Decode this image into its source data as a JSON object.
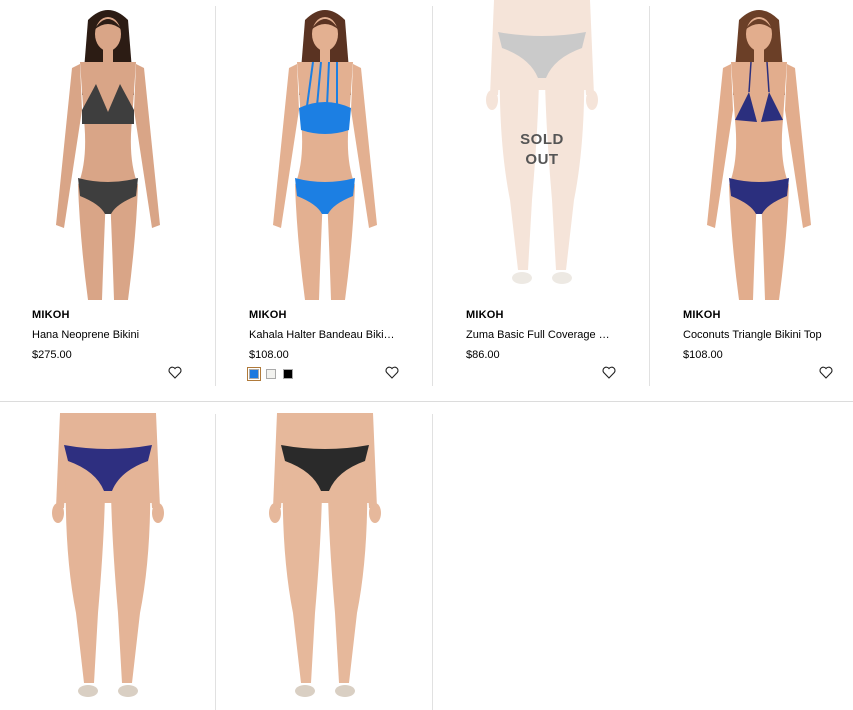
{
  "products": [
    {
      "brand": "MIKOH",
      "name": "Hana Neoprene Bikini",
      "price": "$275.00",
      "heart_icon": "heart-outline-icon",
      "skin": "#d9a587",
      "suit": "#3e3e3e",
      "hair": "#2c1c14"
    },
    {
      "brand": "MIKOH",
      "name": "Kahala Halter Bandeau Biki…",
      "price": "$108.00",
      "heart_icon": "heart-outline-icon",
      "skin": "#e3b091",
      "suit": "#1c7fe3",
      "hair": "#5a3322",
      "swatches": [
        {
          "color": "#1a78e0",
          "selected": true
        },
        {
          "color": "#f2f2ef",
          "selected": false
        },
        {
          "color": "#000000",
          "selected": false
        }
      ]
    },
    {
      "brand": "MIKOH",
      "name": "Zuma Basic Full Coverage …",
      "price": "$86.00",
      "heart_icon": "heart-outline-icon",
      "skin": "#e9c4ad",
      "suit": "#8c8c8c",
      "hair": "",
      "sold_out_line1": "SOLD",
      "sold_out_line2": "OUT"
    },
    {
      "brand": "MIKOH",
      "name": "Coconuts Triangle Bikini Top",
      "price": "$108.00",
      "heart_icon": "heart-outline-icon",
      "skin": "#e2ad8d",
      "suit": "#2b2f7e",
      "hair": "#6b3f27"
    },
    {
      "skin": "#e4b497",
      "suit": "#2e2f80"
    },
    {
      "skin": "#e6b89b",
      "suit": "#2a2a2a"
    }
  ]
}
